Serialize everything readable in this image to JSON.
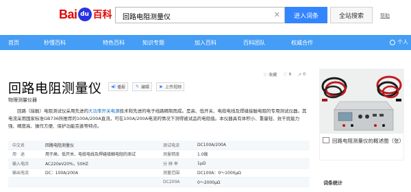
{
  "header": {
    "logo": {
      "bai": "Bai",
      "du": "du",
      "baike": "百科"
    },
    "search_value": "回路电阻测量仪",
    "enter_button": "进入词条",
    "search_button": "全站搜索",
    "help_link": "帮助"
  },
  "nav": {
    "items": [
      "首页",
      "秒懂百科",
      "特色百科",
      "知识专题",
      "加入百科",
      "百科团队",
      "权威合作"
    ],
    "user_label": "个人"
  },
  "entry": {
    "title": "回路电阻测量仪",
    "actions": {
      "broadcast": "播报",
      "edit": "编辑",
      "upload": "上传视频"
    },
    "tools": {
      "collect": "收藏",
      "like": "6",
      "share": "0"
    },
    "subtitle": "物理测量仪器",
    "desc_1": "回路（接触）电阻测试仪采用先进的",
    "desc_link": "大功率开关电源",
    "desc_2": "技术和先进的电子线路精制而成。是高、低开关、电缆电线及焊缝接触电阻的专用测试仪器。其电流采用国家标准GB736所推荐的100A/200A直流，可在100A/200A电流的情况下测得被试品的电阻值。本仪器具有体积小、重量轻、抗干扰能力强、精度高、操作方便、保护功能完善等特点。"
  },
  "info_rows": [
    {
      "k1": "中文名",
      "v1": "回路电阻测量仪",
      "k2": "测试电流",
      "v2": "DC100A/200A"
    },
    {
      "k1": "用　途",
      "v1": "用于高、低开关、电缆电线及焊缝接触电阻的测试",
      "k2": "测量精度",
      "v2": "1.0级"
    },
    {
      "k1": "输入电压",
      "v1": "AC220eV20%，50HZ",
      "k2": "分 辨 率",
      "v2": "1μΩ"
    },
    {
      "k1": "输出电流",
      "v1": "DC：100A/200A",
      "k2": "测量范围",
      "v2": "DC100A：0～1000μΩ"
    },
    {
      "k1": "",
      "v1": "",
      "k2": "DC200A",
      "v2": "0～2000μΩ"
    }
  ],
  "side": {
    "caption": "回路电阻测量仪的概述图（张）",
    "stats_label": "词条统计"
  },
  "colors": {
    "nav_bg": "#459df5",
    "brand_red": "#e10601",
    "brand_blue": "#2932e1",
    "button_blue": "#3385ff",
    "link_blue": "#136ec2"
  }
}
